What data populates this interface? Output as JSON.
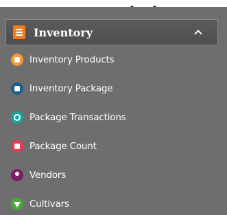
{
  "sidebar": {
    "section": {
      "title": "Inventory",
      "icon": "clipboard-list-icon",
      "toggle_icon": "chevron-up-icon"
    },
    "items": [
      {
        "label": "Inventory Products",
        "icon": "boxes-icon",
        "color": "#f59a33"
      },
      {
        "label": "Inventory Package",
        "icon": "sitemap-icon",
        "color": "#1c5f8e"
      },
      {
        "label": "Package Transactions",
        "icon": "refresh-icon",
        "color": "#18a39b"
      },
      {
        "label": "Package Count",
        "icon": "clipboard-check-icon",
        "color": "#e33d54"
      },
      {
        "label": "Vendors",
        "icon": "user-icon",
        "color": "#7a1f6a"
      },
      {
        "label": "Cultivars",
        "icon": "leaf-icon",
        "color": "#4aa63a"
      }
    ]
  },
  "colors": {
    "panel_background": "#6e6e6e",
    "header_background": "#555555",
    "header_icon": "#f07e1f",
    "text": "#ffffff"
  }
}
